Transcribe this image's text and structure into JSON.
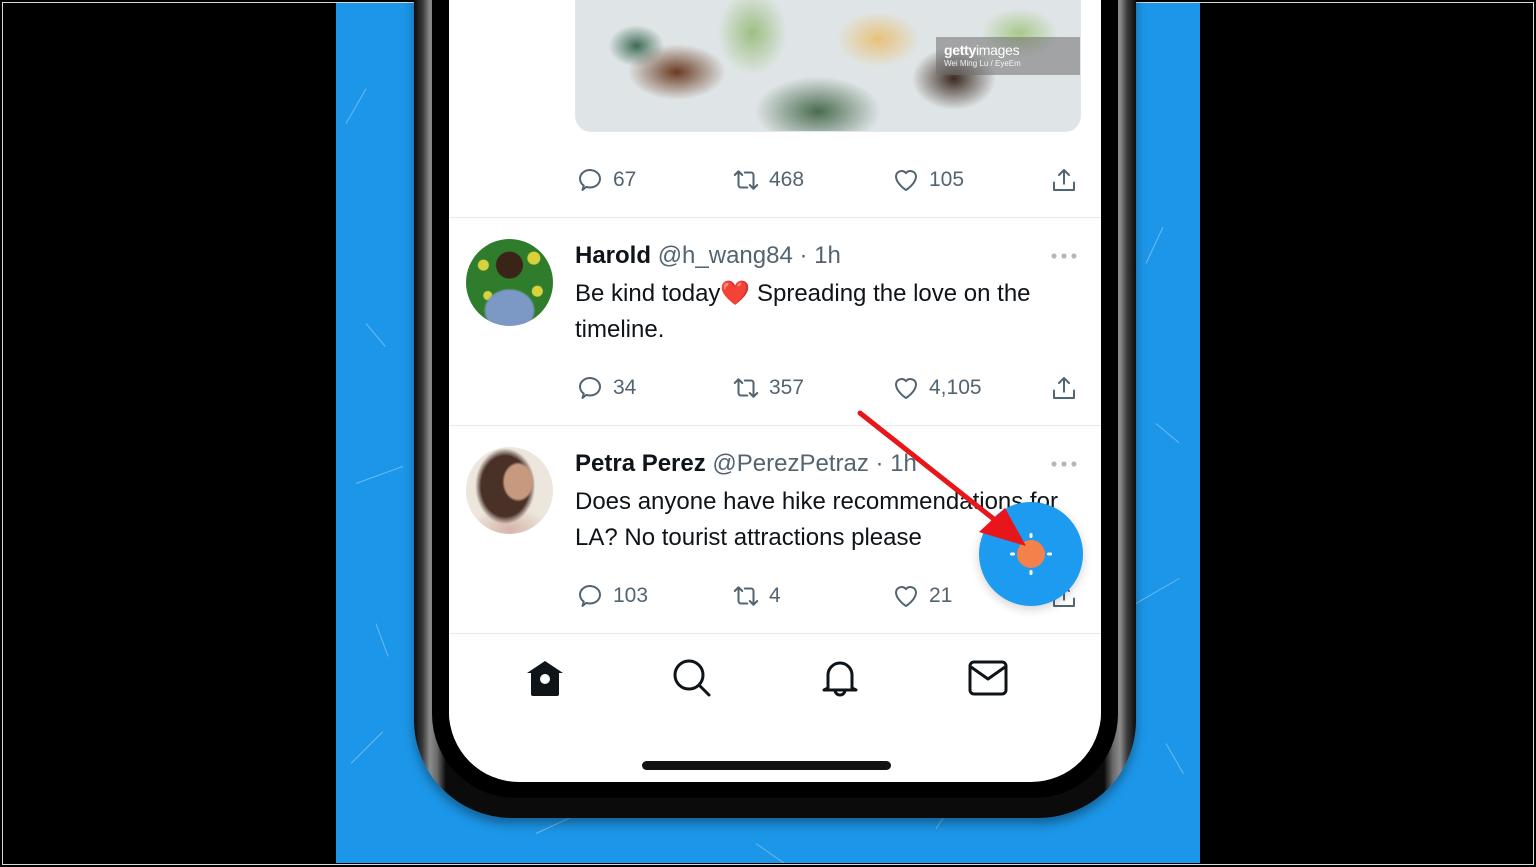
{
  "app": "Twitter",
  "top_tweet": {
    "media": {
      "watermark_brand_bold": "getty",
      "watermark_brand_rest": "images",
      "watermark_credit": "Wei Ming Lu / EyeEm"
    },
    "replies": "67",
    "retweets": "468",
    "likes": "105"
  },
  "tweets": [
    {
      "name": "Harold",
      "handle": "@h_wang84",
      "separator": "·",
      "time": "1h",
      "text": "Be kind today❤️ Spreading the love on the timeline.",
      "replies": "34",
      "retweets": "357",
      "likes": "4,105"
    },
    {
      "name": "Petra Perez",
      "handle": "@PerezPetraz",
      "separator": "·",
      "time": "1h",
      "text": "Does anyone have hike recommendations for LA? No tourist attractions please",
      "replies": "103",
      "retweets": "4",
      "likes": "21"
    }
  ],
  "bottom_nav": {
    "items": [
      {
        "id": "home",
        "icon": "home-icon",
        "active": true
      },
      {
        "id": "search",
        "icon": "search-icon",
        "active": false
      },
      {
        "id": "notifications",
        "icon": "bell-icon",
        "active": false
      },
      {
        "id": "messages",
        "icon": "mail-icon",
        "active": false
      }
    ]
  },
  "fab": {
    "icon": "spaces-compose-icon",
    "accent": "#1d9bf0",
    "inner_color": "#f4804b"
  },
  "annotation": {
    "type": "arrow",
    "color": "#e8151b",
    "points_to": "fab"
  },
  "colors": {
    "background": "#1c96e8",
    "text_primary": "#0f1419",
    "text_secondary": "#536471",
    "divider": "#e6eaed"
  }
}
